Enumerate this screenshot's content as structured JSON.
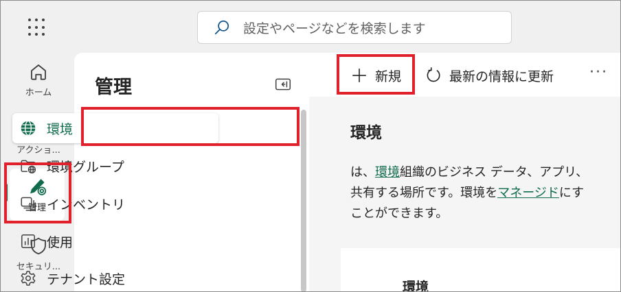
{
  "search": {
    "placeholder": "設定やページなどを検索します"
  },
  "rail": {
    "home": "ホーム",
    "actions": "アクショ...",
    "admin": "管理",
    "security": "セキュリ..."
  },
  "nav": {
    "title": "管理",
    "items": [
      {
        "label": "環境",
        "icon": "globe-icon",
        "selected": true
      },
      {
        "label": "環境グループ",
        "icon": "folder-globe-icon"
      },
      {
        "label": "インベントリ",
        "icon": "stack-icon"
      },
      {
        "label": "使用",
        "icon": "chart-icon"
      },
      {
        "label": "テナント設定",
        "icon": "gear-icon"
      }
    ]
  },
  "toolbar": {
    "new_label": "新規",
    "refresh_label": "最新の情報に更新",
    "more_label": "···"
  },
  "main": {
    "title": "環境",
    "desc": {
      "l1_a": "は、",
      "l1_link": "環境",
      "l1_b": "組織のビジネス データ、アプリ、",
      "l2_a": "共有する場所です。環境を",
      "l2_link": "マネージド",
      "l2_b": "にす",
      "l3": "ことができます。"
    },
    "card_title": "環境"
  },
  "colors": {
    "accent": "#0f6b4b",
    "highlight": "#e0202a"
  }
}
